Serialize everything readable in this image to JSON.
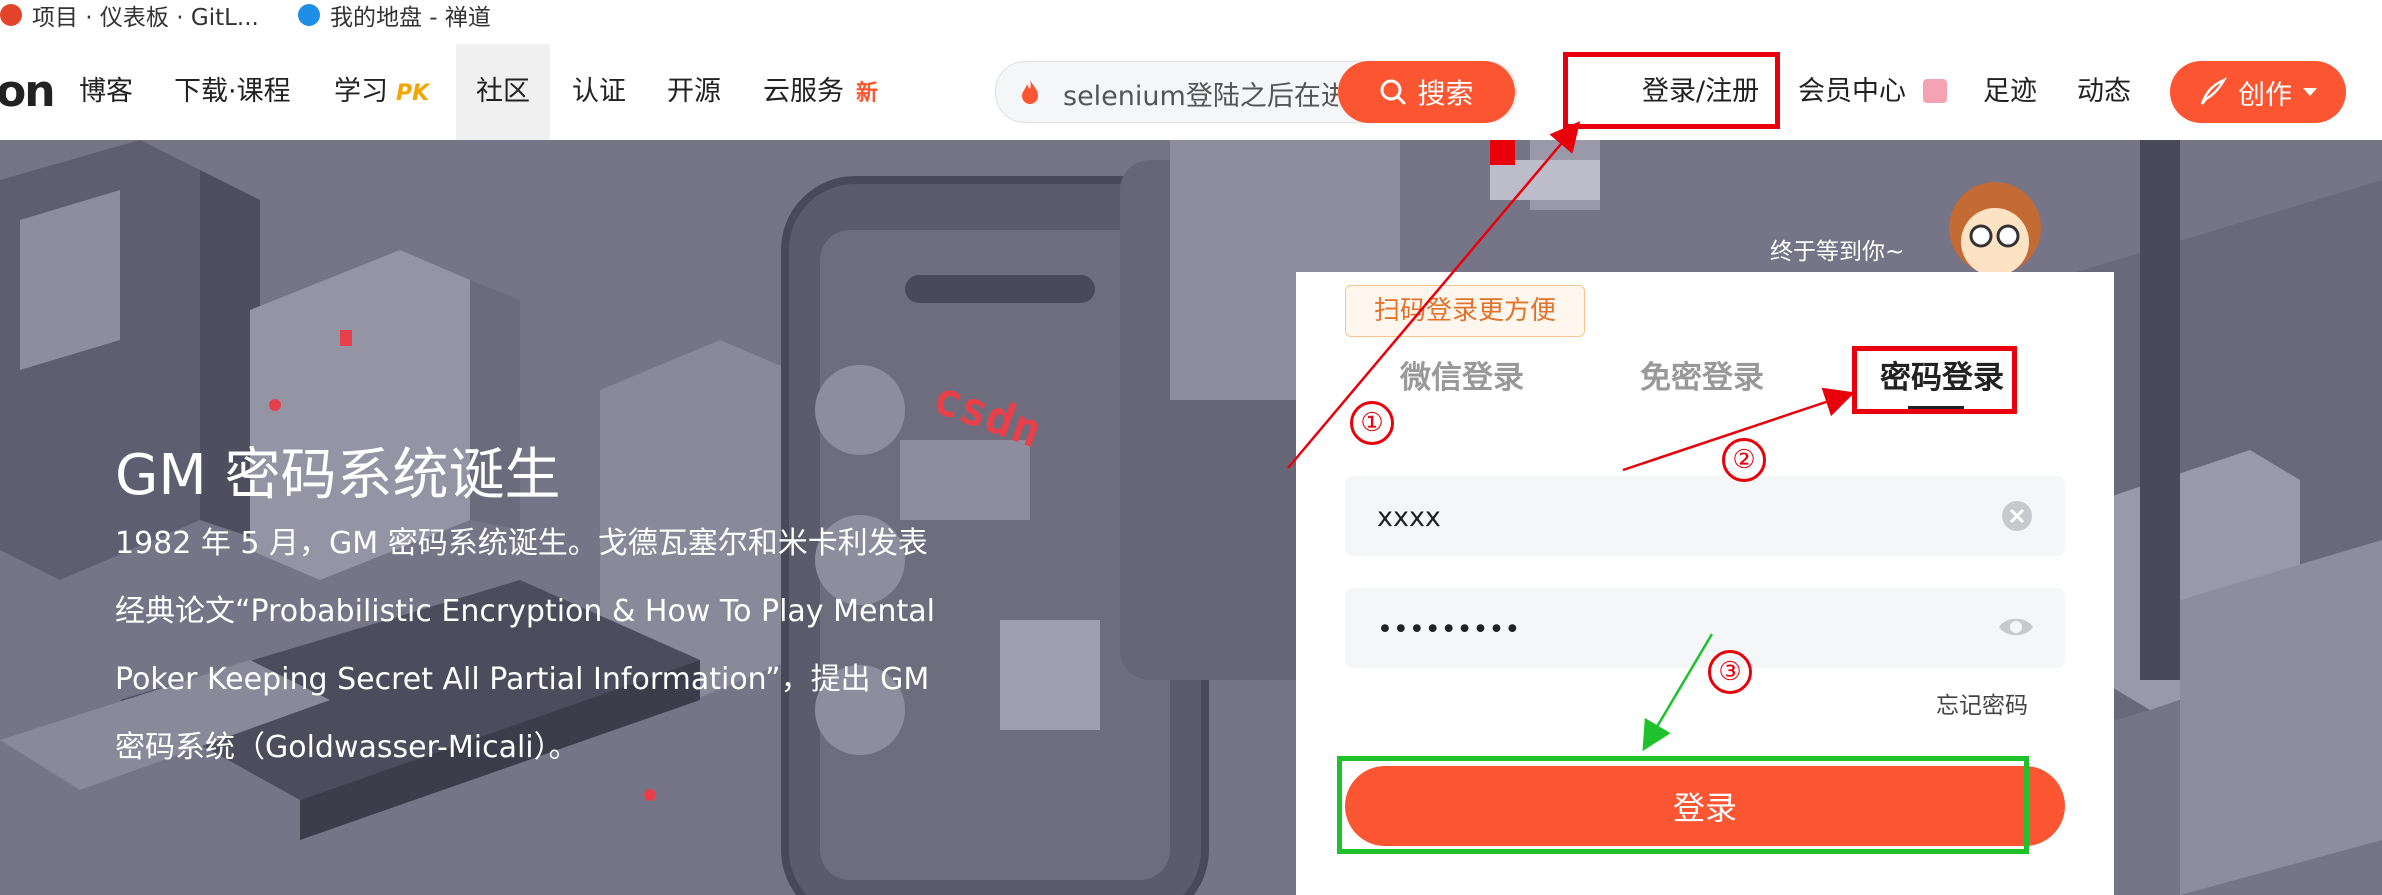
{
  "bookmarks": [
    {
      "label": "项目 · 仪表板 · GitL...",
      "icon": "gitlab-icon"
    },
    {
      "label": "我的地盘 - 禅道",
      "icon": "zentao-icon"
    }
  ],
  "nav": {
    "logo": "on",
    "items": [
      {
        "label": "博客"
      },
      {
        "label": "下载·课程"
      },
      {
        "label": "学习",
        "badge": "PK"
      },
      {
        "label": "社区"
      },
      {
        "label": "认证"
      },
      {
        "label": "开源"
      },
      {
        "label": "云服务",
        "badge": "新"
      }
    ],
    "search": {
      "value": "selenium登陆之后在进",
      "button": "搜索"
    },
    "right": {
      "login": "登录/注册",
      "member": "会员中心",
      "footprint": "足迹",
      "dynamic": "动态",
      "create": "创作"
    }
  },
  "hero": {
    "title": "GM 密码系统诞生",
    "body": "1982 年 5 月，GM 密码系统诞生。戈德瓦塞尔和米卡利发表经典论文“Probabilistic Encryption & How To Play Mental Poker Keeping Secret All Partial Information”，提出 GM 密码系统（Goldwasser-Micali）。",
    "logo_text": "csdn"
  },
  "login_panel": {
    "greeting": "终于等到你~",
    "qr_tip": "扫码登录更方便",
    "tabs": [
      "微信登录",
      "免密登录",
      "密码登录"
    ],
    "active_tab": "密码登录",
    "username": "xxxx",
    "password": "•••••••••",
    "forgot": "忘记密码",
    "submit": "登录"
  },
  "annotations": {
    "step1": "①",
    "step2": "②",
    "step3": "③"
  },
  "colors": {
    "accent": "#fc5531",
    "highlight_red": "#e8000b",
    "highlight_green": "#1fc22d"
  }
}
